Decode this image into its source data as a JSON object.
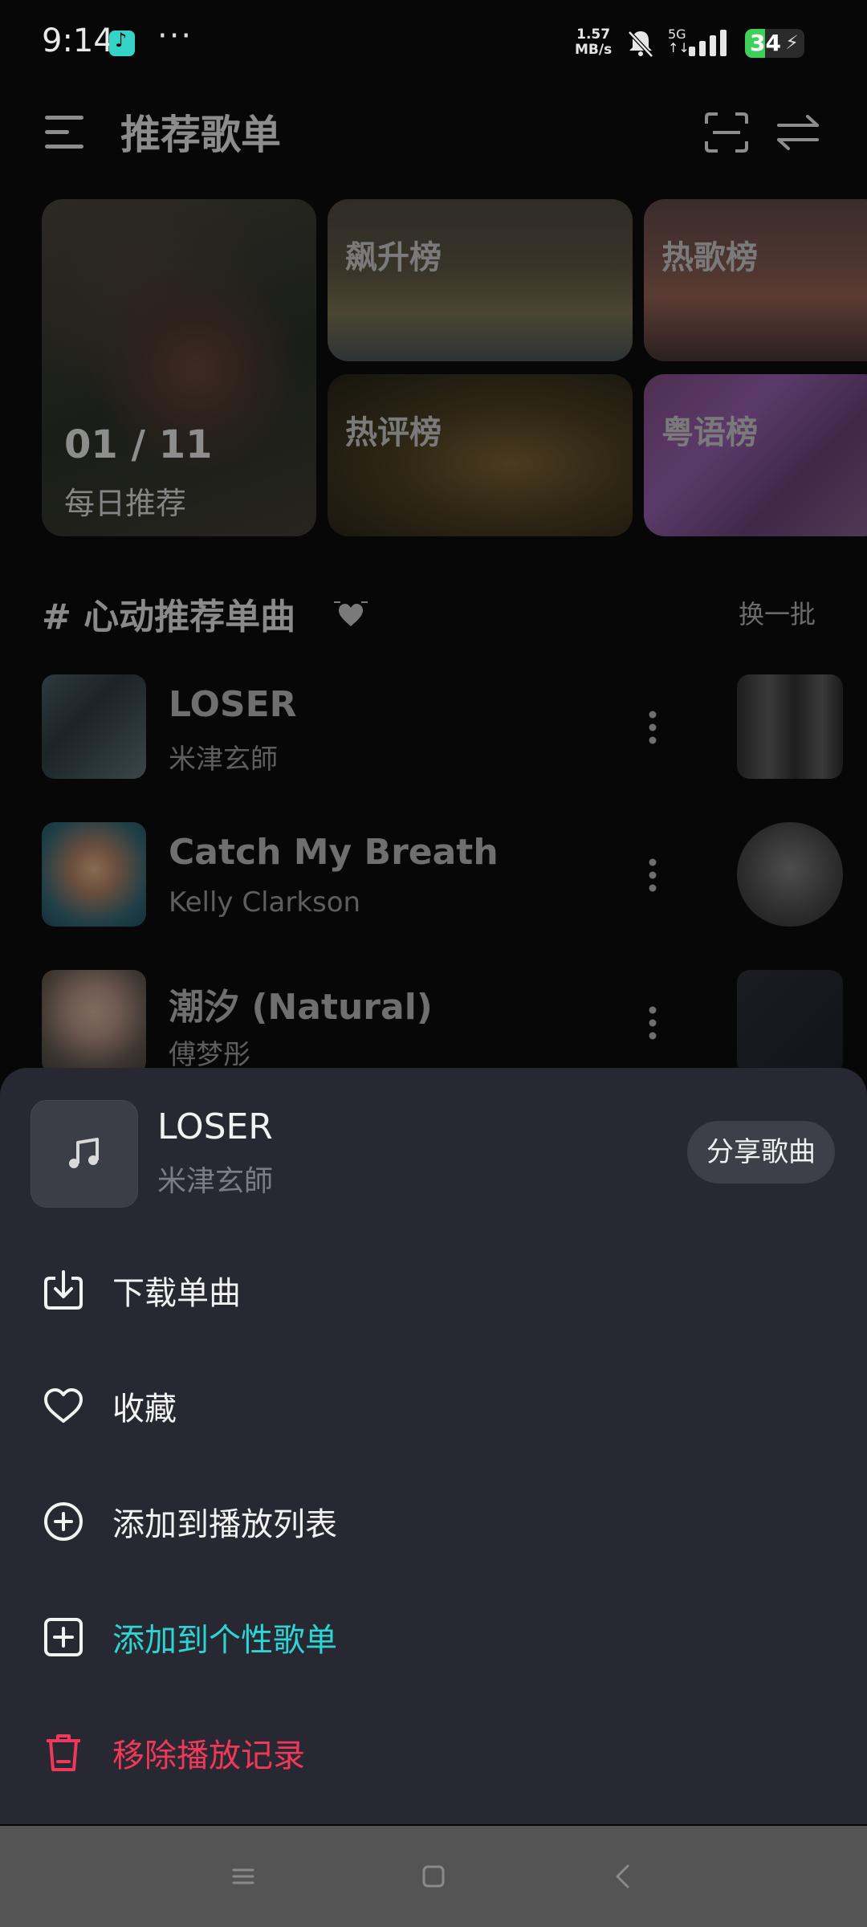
{
  "status": {
    "time": "9:14",
    "dots": "···",
    "net_speed_line1": "1.57",
    "net_speed_line2": "MB/s",
    "signal_label_line1": "5G",
    "signal_label_line2": "↑↓",
    "battery_level": "34",
    "battery_charging_glyph": "⚡"
  },
  "header": {
    "title": "推荐歌单"
  },
  "cards": {
    "daily_count": "01 / 11",
    "daily_label": "每日推荐",
    "rise_label": "飙升榜",
    "hot_label": "热歌榜",
    "comment_label": "热评榜",
    "canto_label": "粤语榜"
  },
  "section": {
    "title": "# 心动推荐单曲",
    "refresh_label": "换一批"
  },
  "songs": [
    {
      "title": "LOSER",
      "artist": "米津玄師"
    },
    {
      "title": "Catch My Breath",
      "artist": "Kelly Clarkson"
    },
    {
      "title": "潮汐 (Natural)",
      "artist": "傅梦彤"
    }
  ],
  "sheet": {
    "song_title": "LOSER",
    "song_artist": "米津玄師",
    "share_label": "分享歌曲",
    "items": [
      {
        "label": "下载单曲",
        "color": "#f2f2f2"
      },
      {
        "label": "收藏",
        "color": "#f2f2f2"
      },
      {
        "label": "添加到播放列表",
        "color": "#f2f2f2"
      },
      {
        "label": "添加到个性歌单",
        "color": "#2dd4d4"
      },
      {
        "label": "移除播放记录",
        "color": "#f0395a"
      }
    ]
  },
  "colors": {
    "accent_cyan": "#2dd4d4",
    "danger_red": "#f0395a",
    "sheet_bg": "#272831"
  }
}
